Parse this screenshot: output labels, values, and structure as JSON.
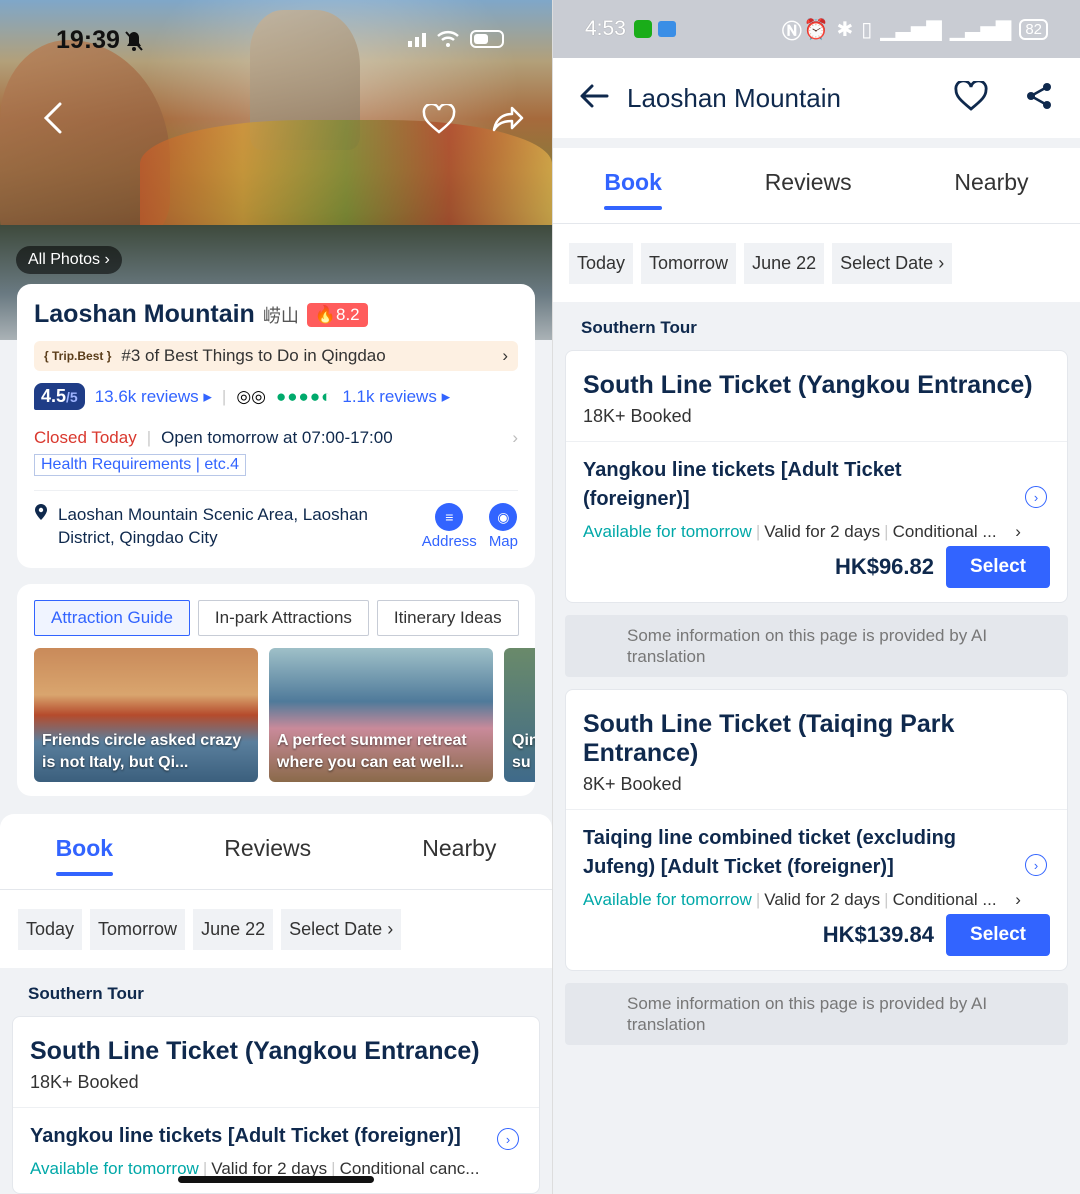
{
  "left": {
    "status": {
      "time": "19:39"
    },
    "hero": {
      "all_photos": "All Photos"
    },
    "poi": {
      "title": "Laoshan Mountain",
      "title_cn": "崂山",
      "heat": "8.2",
      "tripbest_badge": "Trip.Best",
      "tripbest_text": "#3 of Best Things to Do in Qingdao",
      "score": "4.5",
      "score_max": "/5",
      "reviews": "13.6k reviews",
      "ta_reviews": "1.1k reviews",
      "closed": "Closed Today",
      "hours": "Open tomorrow at 07:00-17:00",
      "health": "Health Requirements | etc.4",
      "address": "Laoshan Mountain Scenic Area, Laoshan District, Qingdao City",
      "address_btn": "Address",
      "map_btn": "Map"
    },
    "guide": {
      "chips": [
        "Attraction Guide",
        "In-park Attractions",
        "Itinerary Ideas"
      ],
      "thumbs": [
        {
          "caption": "Friends circle asked crazy is not Italy, but Qi..."
        },
        {
          "caption": "A perfect summer retreat where you can eat well..."
        },
        {
          "caption": "Qin su"
        }
      ]
    },
    "tabs": [
      "Book",
      "Reviews",
      "Nearby"
    ],
    "dates": [
      "Today",
      "Tomorrow",
      "June 22",
      "Select Date"
    ],
    "section": "Southern Tour",
    "product": {
      "name": "South Line Ticket (Yangkou Entrance)",
      "booked": "18K+ Booked",
      "item_title": "Yangkou line tickets [Adult Ticket (foreigner)]",
      "avail": "Available for tomorrow",
      "valid": "Valid for 2 days",
      "cond": "Conditional canc..."
    }
  },
  "right": {
    "status": {
      "time": "4:53",
      "battery": "82"
    },
    "title": "Laoshan Mountain",
    "tabs": [
      "Book",
      "Reviews",
      "Nearby"
    ],
    "dates": [
      "Today",
      "Tomorrow",
      "June 22",
      "Select Date"
    ],
    "section": "Southern Tour",
    "products": [
      {
        "name": "South Line Ticket (Yangkou Entrance)",
        "booked": "18K+ Booked",
        "item_title": "Yangkou line tickets [Adult Ticket (foreigner)]",
        "avail": "Available for tomorrow",
        "valid": "Valid for 2 days",
        "cond": "Conditional ...",
        "price": "HK$96.82",
        "select": "Select"
      },
      {
        "name": "South Line Ticket (Taiqing Park Entrance)",
        "booked": "8K+ Booked",
        "item_title": "Taiqing line combined ticket (excluding Jufeng) [Adult Ticket (foreigner)]",
        "avail": "Available for tomorrow",
        "valid": "Valid for 2 days",
        "cond": "Conditional ...",
        "price": "HK$139.84",
        "select": "Select"
      }
    ],
    "ai_note": "Some information on this page is provided by AI translation"
  },
  "colors": {
    "accent": "#3264ff",
    "navy": "#0f294d",
    "teal": "#00a8a8",
    "closed": "#d9382e",
    "heat": "#ff5c5c"
  }
}
